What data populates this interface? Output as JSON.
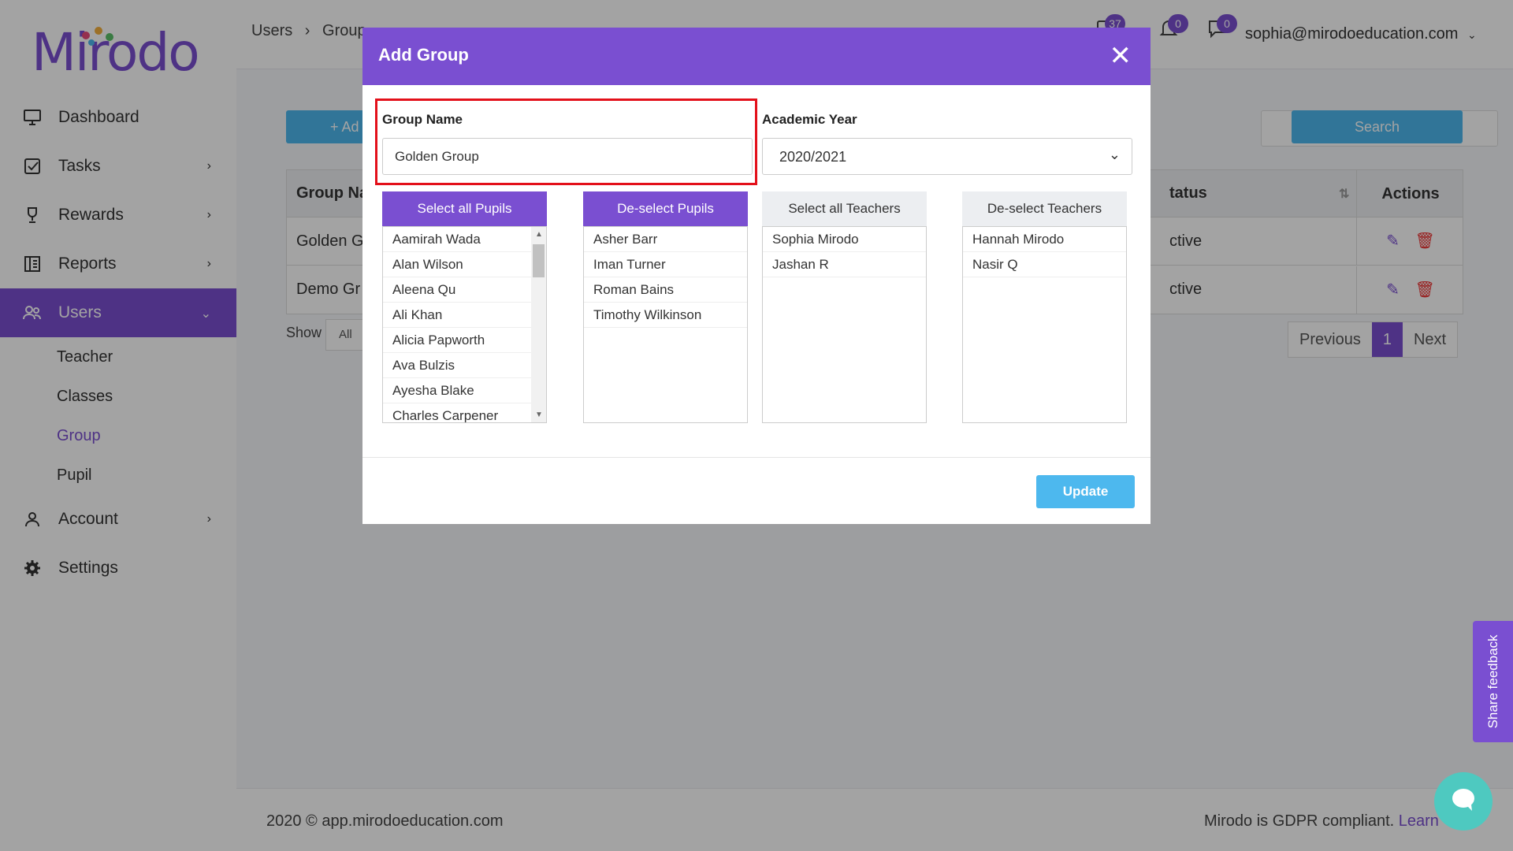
{
  "app": {
    "name": "Mirodo"
  },
  "sidebar": {
    "items": [
      {
        "label": "Dashboard",
        "icon": "monitor-icon"
      },
      {
        "label": "Tasks",
        "icon": "tasks-icon"
      },
      {
        "label": "Rewards",
        "icon": "trophy-icon"
      },
      {
        "label": "Reports",
        "icon": "reports-icon"
      },
      {
        "label": "Users",
        "icon": "users-icon"
      },
      {
        "label": "Account",
        "icon": "account-icon"
      },
      {
        "label": "Settings",
        "icon": "gear-icon"
      }
    ],
    "sub_items": [
      {
        "label": "Teacher"
      },
      {
        "label": "Classes"
      },
      {
        "label": "Group"
      },
      {
        "label": "Pupil"
      }
    ]
  },
  "header": {
    "breadcrumb": [
      "Users",
      "Group"
    ],
    "notifications": {
      "tasks": "37",
      "bell": "0",
      "messages": "0"
    },
    "user_email": "sophia@mirodoeducation.com"
  },
  "page": {
    "add_label": "Ad",
    "search_label": "Search",
    "table": {
      "headers": [
        "Group Na",
        "tatus",
        "Actions"
      ],
      "rows": [
        {
          "name": "Golden G",
          "status": "ctive"
        },
        {
          "name": "Demo Gr",
          "status": "ctive"
        }
      ]
    },
    "show_label": "Show",
    "show_value": "All",
    "pager": {
      "prev": "Previous",
      "current": "1",
      "next": "Next"
    }
  },
  "footer": {
    "left": "2020 © app.mirodoeducation.com",
    "right": "Mirodo is GDPR compliant.",
    "link": "Learn"
  },
  "feedback": {
    "label": "Share feedback"
  },
  "modal": {
    "title": "Add Group",
    "group_name_label": "Group Name",
    "group_name_value": "Golden Group",
    "year_label": "Academic Year",
    "year_value": "2020/2021",
    "select_all_pupils": "Select all Pupils",
    "deselect_pupils": "De-select Pupils",
    "select_all_teachers": "Select all Teachers",
    "deselect_teachers": "De-select Teachers",
    "available_pupils": [
      "Aamirah Wada",
      "Alan Wilson",
      "Aleena Qu",
      "Ali Khan",
      "Alicia Papworth",
      "Ava Bulzis",
      "Ayesha Blake",
      "Charles Carpener"
    ],
    "selected_pupils": [
      "Asher Barr",
      "Iman Turner",
      "Roman Bains",
      "Timothy Wilkinson"
    ],
    "available_teachers": [
      "Sophia Mirodo",
      "Jashan R"
    ],
    "selected_teachers": [
      "Hannah Mirodo",
      "Nasir Q"
    ],
    "update_label": "Update"
  },
  "colors": {
    "accent": "#7a4fd1",
    "button_blue": "#4db8ee",
    "highlight_red": "#e3101a",
    "chat": "#4ec9c0"
  }
}
